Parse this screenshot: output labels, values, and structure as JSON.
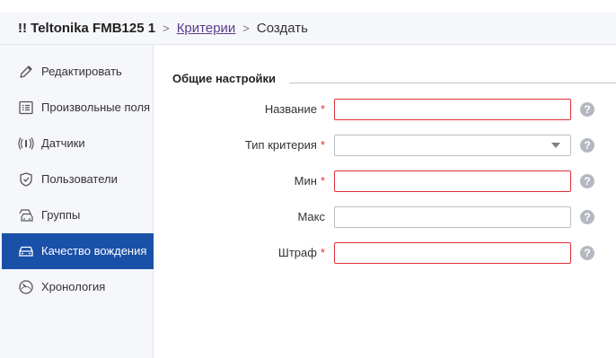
{
  "header": {
    "device": "!! Teltonika FMB125 1",
    "breadcrumb_link": "Критерии",
    "breadcrumb_current": "Создать",
    "separator": ">"
  },
  "sidebar": {
    "items": [
      {
        "label": "Редактировать",
        "icon": "pencil-icon"
      },
      {
        "label": "Произвольные поля",
        "icon": "list-icon"
      },
      {
        "label": "Датчики",
        "icon": "sensor-icon"
      },
      {
        "label": "Пользователи",
        "icon": "shield-icon"
      },
      {
        "label": "Группы",
        "icon": "cars-icon"
      },
      {
        "label": "Качество вождения",
        "icon": "car-icon",
        "active": true
      },
      {
        "label": "Хронология",
        "icon": "gauge-icon"
      }
    ]
  },
  "form": {
    "section_title": "Общие настройки",
    "required_mark": "*",
    "help_symbol": "?",
    "fields": [
      {
        "label": "Название",
        "required": true,
        "value": ""
      },
      {
        "label": "Тип критерия",
        "required": true,
        "value": ""
      },
      {
        "label": "Мин",
        "required": true,
        "value": ""
      },
      {
        "label": "Макс",
        "required": false,
        "value": ""
      },
      {
        "label": "Штраф",
        "required": true,
        "value": ""
      }
    ]
  },
  "colors": {
    "accent": "#1950a8",
    "required": "#dd2f3b",
    "link": "#5a3e8c"
  }
}
